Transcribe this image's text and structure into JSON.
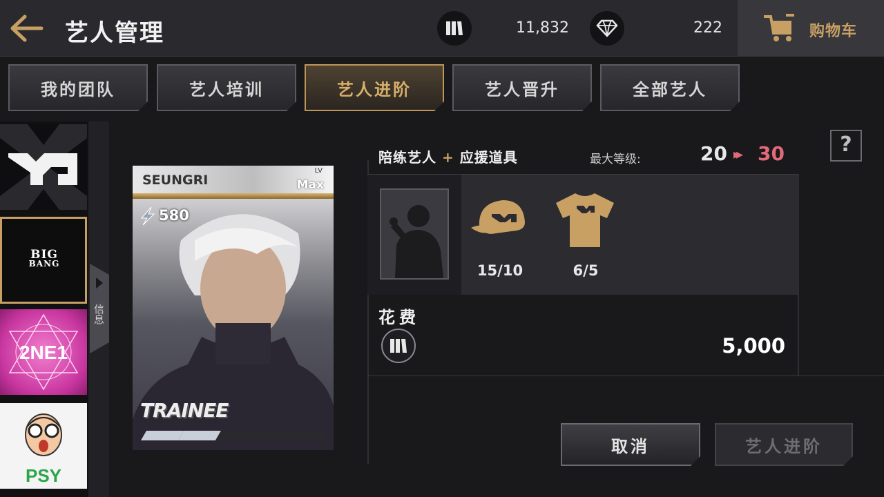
{
  "header": {
    "title": "艺人管理",
    "coins": "11,832",
    "gems": "222",
    "cart_label": "购物车"
  },
  "tabs": [
    {
      "label": "我的团队",
      "active": false
    },
    {
      "label": "艺人培训",
      "active": false
    },
    {
      "label": "艺人进阶",
      "active": true
    },
    {
      "label": "艺人晋升",
      "active": false
    },
    {
      "label": "全部艺人",
      "active": false
    }
  ],
  "sidebar": {
    "info_label": "信息",
    "groups": [
      {
        "label": "YG",
        "selected": false
      },
      {
        "label": "BIG BANG",
        "selected": true
      },
      {
        "label": "2NE1",
        "selected": false
      },
      {
        "label": "PSY",
        "selected": false
      }
    ]
  },
  "card": {
    "name": "SEUNGRI",
    "level_label": "LV",
    "level_value": "Max",
    "power": "580",
    "rank": "TRAINEE",
    "progress_filled": 2,
    "progress_total": 5
  },
  "panel": {
    "requirement_label_a": "陪练艺人",
    "plus": "+",
    "requirement_label_b": "应援道具",
    "max_level_label": "最大等级:",
    "level_from": "20",
    "level_arrow": "▸▸",
    "level_to": "30",
    "help": "?",
    "items": [
      {
        "icon": "cap-icon",
        "qty": "15/10"
      },
      {
        "icon": "tshirt-icon",
        "qty": "6/5"
      }
    ],
    "cost_label": "花费",
    "cost_amount": "5,000",
    "cancel_label": "取消",
    "advance_label": "艺人进阶"
  },
  "colors": {
    "accent_gold": "#c8a064",
    "level_up_pink": "#e36a78"
  }
}
